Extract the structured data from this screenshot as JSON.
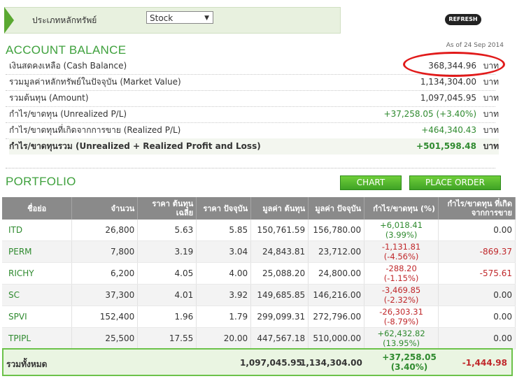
{
  "header": {
    "security_type_label": "ประเภทหลักทรัพย์",
    "security_type_value": "Stock",
    "refresh_label": "REFRESH"
  },
  "account": {
    "title": "ACCOUNT BALANCE",
    "as_of": "As of 24 Sep 2014",
    "unit": "บาท",
    "rows": [
      {
        "label": "เงินสดคงเหลือ (Cash Balance)",
        "value": "368,344.96"
      },
      {
        "label": "รวมมูลค่าหลักทรัพย์ในปัจจุบัน (Market Value)",
        "value": "1,134,304.00"
      },
      {
        "label": "รวมต้นทุน (Amount)",
        "value": "1,097,045.95"
      },
      {
        "label": "กำไร/ขาดทุน (Unrealized P/L)",
        "value": "+37,258.05 (+3.40%)"
      },
      {
        "label": "กำไร/ขาดทุนที่เกิดจากการขาย (Realized P/L)",
        "value": "+464,340.43"
      },
      {
        "label": "กำไร/ขาดทุนรวม (Unrealized + Realized Profit and Loss)",
        "value": "+501,598.48"
      }
    ]
  },
  "portfolio": {
    "title": "PORTFOLIO",
    "chart_label": "CHART",
    "place_order_label": "PLACE ORDER",
    "columns": [
      "ชื่อย่อ",
      "จำนวน",
      "ราคา ต้นทุนเฉลี่ย",
      "ราคา ปัจจุบัน",
      "มูลค่า ต้นทุน",
      "มูลค่า ปัจจุบัน",
      "กำไร/ขาดทุน (%)",
      "กำไร/ขาดทุน ที่เกิดจากการขาย"
    ],
    "rows": [
      {
        "symbol": "ITD",
        "qty": "26,800",
        "avg": "5.63",
        "price": "5.85",
        "cost": "150,761.59",
        "market": "156,780.00",
        "pl": "+6,018.41",
        "pl_pct": "(3.99%)",
        "realized": "0.00"
      },
      {
        "symbol": "PERM",
        "qty": "7,800",
        "avg": "3.19",
        "price": "3.04",
        "cost": "24,843.81",
        "market": "23,712.00",
        "pl": "-1,131.81",
        "pl_pct": "(-4.56%)",
        "realized": "-869.37"
      },
      {
        "symbol": "RICHY",
        "qty": "6,200",
        "avg": "4.05",
        "price": "4.00",
        "cost": "25,088.20",
        "market": "24,800.00",
        "pl": "-288.20",
        "pl_pct": "(-1.15%)",
        "realized": "-575.61"
      },
      {
        "symbol": "SC",
        "qty": "37,300",
        "avg": "4.01",
        "price": "3.92",
        "cost": "149,685.85",
        "market": "146,216.00",
        "pl": "-3,469.85",
        "pl_pct": "(-2.32%)",
        "realized": "0.00"
      },
      {
        "symbol": "SPVI",
        "qty": "152,400",
        "avg": "1.96",
        "price": "1.79",
        "cost": "299,099.31",
        "market": "272,796.00",
        "pl": "-26,303.31",
        "pl_pct": "(-8.79%)",
        "realized": "0.00"
      },
      {
        "symbol": "TPIPL",
        "qty": "25,500",
        "avg": "17.55",
        "price": "20.00",
        "cost": "447,567.18",
        "market": "510,000.00",
        "pl": "+62,432.82",
        "pl_pct": "(13.95%)",
        "realized": "0.00"
      }
    ],
    "total": {
      "label": "รวมทั้งหมด",
      "cost": "1,097,045.95",
      "market": "1,134,304.00",
      "pl": "+37,258.05",
      "pl_pct": "(3.40%)",
      "realized": "-1,444.98"
    }
  },
  "colors": {
    "accent_green": "#3fa13d",
    "positive": "#2f8a2f",
    "negative": "#c0282b",
    "highlight_circle": "#e11a1a"
  }
}
